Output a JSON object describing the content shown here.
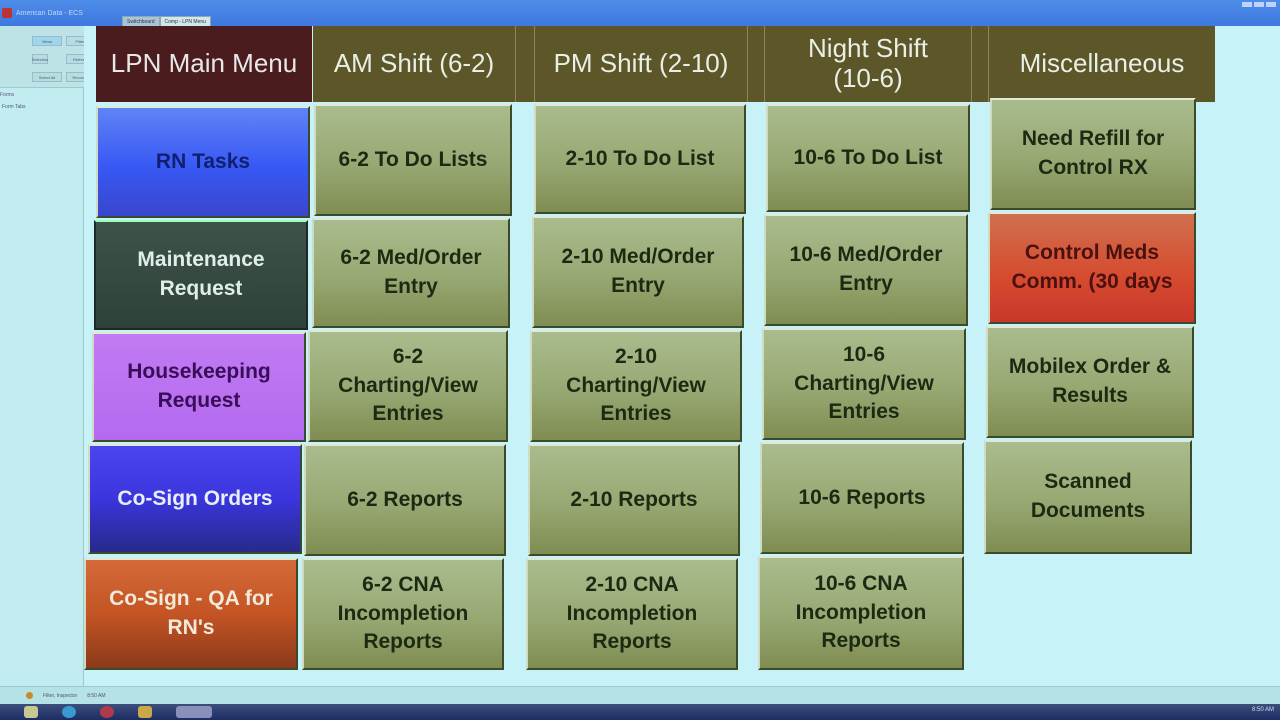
{
  "window": {
    "title": "American Data - ECS",
    "doc_tabs": [
      "Switchboard",
      "Comp - LPN Menu"
    ],
    "active_tab": 1
  },
  "navpane": {
    "ribbon_buttons": [
      "Views",
      "Filter",
      "Selection",
      "Refresh",
      "Select All",
      "Records"
    ],
    "header": "Forms",
    "items": [
      "Form Tabs"
    ]
  },
  "headers": {
    "main_menu": "LPN Main Menu",
    "am_shift": "AM Shift (6-2)",
    "pm_shift": "PM Shift (2-10)",
    "night_shift": "Night Shift (10-6)",
    "misc": "Miscellaneous"
  },
  "columns": {
    "main": [
      {
        "label": "RN Tasks",
        "style": "blue1"
      },
      {
        "label": "Maintenance Request",
        "style": "slate"
      },
      {
        "label": "Housekeeping Request",
        "style": "violet"
      },
      {
        "label": "Co-Sign Orders",
        "style": "blue2"
      },
      {
        "label": "Co-Sign - QA for RN's",
        "style": "orange"
      }
    ],
    "am": [
      {
        "label": "6-2  To Do Lists"
      },
      {
        "label": "6-2 Med/Order Entry"
      },
      {
        "label": "6-2 Charting/View Entries"
      },
      {
        "label": "6-2  Reports"
      },
      {
        "label": "6-2 CNA Incompletion Reports"
      }
    ],
    "pm": [
      {
        "label": "2-10 To Do List"
      },
      {
        "label": "2-10  Med/Order Entry"
      },
      {
        "label": "2-10 Charting/View Entries"
      },
      {
        "label": "2-10 Reports"
      },
      {
        "label": "2-10 CNA Incompletion Reports"
      }
    ],
    "night": [
      {
        "label": "10-6 To Do List"
      },
      {
        "label": "10-6  Med/Order Entry"
      },
      {
        "label": "10-6 Charting/View Entries"
      },
      {
        "label": "10-6 Reports"
      },
      {
        "label": "10-6 CNA Incompletion Reports"
      }
    ],
    "misc": [
      {
        "label": "Need Refill for Control RX",
        "style": "olive"
      },
      {
        "label": "Control Meds Comm. (30 days",
        "style": "red"
      },
      {
        "label": "Mobilex Order & Results",
        "style": "olive"
      },
      {
        "label": "Scanned Documents",
        "style": "olive"
      }
    ]
  },
  "statusbar": {
    "record": "Filter, Inspector",
    "time": "8:50 AM"
  },
  "taskbar": {
    "clock": "8:50 AM"
  },
  "colors": {
    "header_olive": "#5c5628",
    "header_maroon": "#4a1c1e",
    "form_background": "#c7f3f8",
    "button_olive": "#98a873"
  }
}
